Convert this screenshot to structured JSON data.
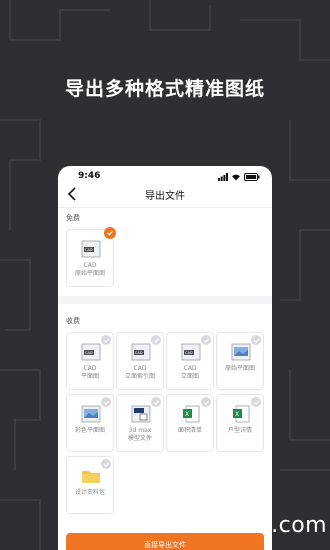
{
  "promo": {
    "headline": "导出多种格式精准图纸"
  },
  "statusbar": {
    "time": "9:46"
  },
  "navbar": {
    "title": "导出文件"
  },
  "free_section": {
    "label": "免费",
    "items": [
      {
        "label": "CAD\n原始平面图",
        "icon": "cad-file-icon",
        "checked": true
      }
    ]
  },
  "paid_section": {
    "label": "收费",
    "items": [
      {
        "label": "CAD\n平面图",
        "icon": "cad-file-icon",
        "checked": false
      },
      {
        "label": "CAD\n立面索引图",
        "icon": "cad-file-icon",
        "checked": false
      },
      {
        "label": "CAD\n立面图",
        "icon": "cad-file-icon",
        "checked": false
      },
      {
        "label": "原始平面图",
        "icon": "image-file-icon",
        "checked": false
      },
      {
        "label": "彩色平面图",
        "icon": "image-file-icon",
        "checked": false
      },
      {
        "label": "3d max\n模型文件",
        "icon": "3dmax-file-icon",
        "checked": false
      },
      {
        "label": "面积清单",
        "icon": "excel-file-icon",
        "checked": false
      },
      {
        "label": "户型详情",
        "icon": "excel-file-icon",
        "checked": false
      },
      {
        "label": "设计资料包",
        "icon": "folder-icon",
        "checked": false
      }
    ]
  },
  "export_button": {
    "label": "直接导出文件"
  },
  "watermark": {
    "text": "xfdown.com"
  },
  "colors": {
    "accent": "#f07522",
    "background": "#2e2f33"
  }
}
